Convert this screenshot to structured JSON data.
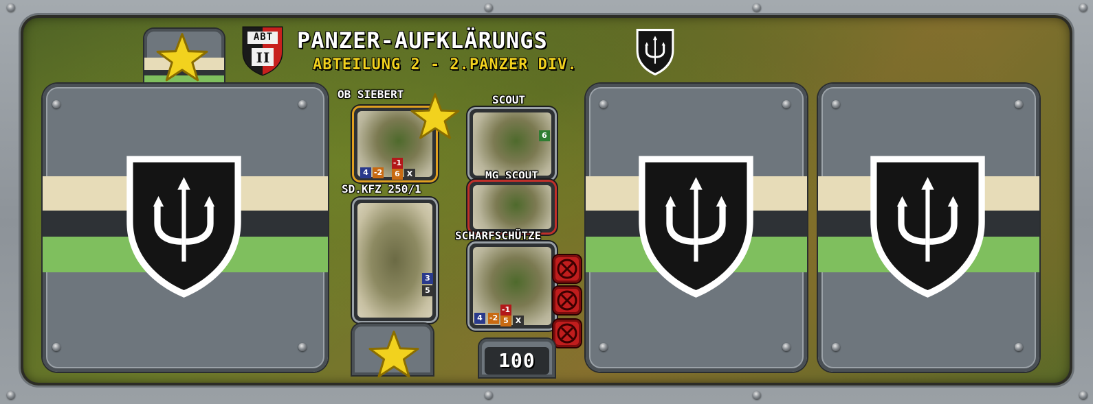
{
  "header": {
    "badge_top": "ABT",
    "badge_bottom": "II",
    "title_line1": "PANZER-AUFKLÄRUNGS",
    "title_line2": "ABTEILUNG 2 - 2.PANZER DIV."
  },
  "units": [
    {
      "name": "OB SIEBERT",
      "card_side_text": "SIEBERT",
      "stats": [
        "4",
        "-2",
        "-1",
        "6",
        "X"
      ]
    },
    {
      "name": "SCOUT",
      "card_side_text": "SCOUT",
      "stats": [
        "6"
      ]
    },
    {
      "name": "MG SCOUT",
      "card_side_text": "SCOUT",
      "stats": []
    },
    {
      "name": "SD.KFZ 250/1",
      "card_side_text": "SD.KFZ 250/1",
      "stats": [
        "3",
        "5"
      ]
    },
    {
      "name": "SCHARFSCHÜTZE",
      "card_side_text": "SCHARFSCHÜTZE",
      "stats": [
        "4",
        "-2",
        "-1",
        "5",
        "X"
      ]
    }
  ],
  "points": "100",
  "colors": {
    "gold": "#f2d21e",
    "stripe_cream": "#e7dcb8",
    "stripe_dark": "#2e3236",
    "stripe_green": "#7fbf5e",
    "slot_gray": "#6e767d",
    "remove_red": "#c01d1d"
  },
  "icons": {
    "division": "trident-shield-icon",
    "star": "star-icon",
    "remove": "close-icon"
  }
}
